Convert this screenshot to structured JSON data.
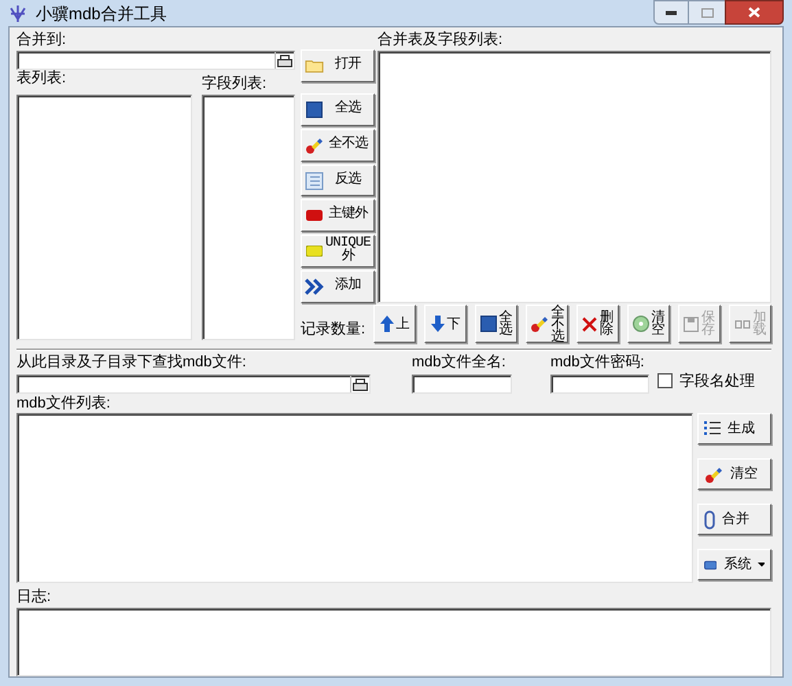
{
  "window": {
    "title": "小骥mdb合并工具"
  },
  "merge_to": {
    "label": "合并到:"
  },
  "table_list": {
    "label": "表列表:"
  },
  "field_list": {
    "label": "字段列表:"
  },
  "side_buttons": [
    {
      "label": "打开",
      "kind": "folder"
    },
    {
      "label": "全选",
      "kind": "square"
    },
    {
      "label": "全不选",
      "kind": "eraser"
    },
    {
      "label": "反选",
      "kind": "list"
    },
    {
      "label": "主键外",
      "kind": "red-pill"
    },
    {
      "label": "UNIQUE外",
      "kind": "yellow-pill"
    },
    {
      "label": "添加",
      "kind": "chevrons"
    }
  ],
  "merge_list": {
    "label": "合并表及字段列表:"
  },
  "record_count": {
    "label": "记录数量:"
  },
  "list_buttons": [
    {
      "label": "上",
      "kind": "up",
      "disabled": false
    },
    {
      "label": "下",
      "kind": "down",
      "disabled": false
    },
    {
      "label": "全选",
      "kind": "square",
      "disabled": false
    },
    {
      "label": "全不选",
      "kind": "eraser",
      "disabled": false
    },
    {
      "label": "删除",
      "kind": "x",
      "disabled": false
    },
    {
      "label": "清空",
      "kind": "disc",
      "disabled": false
    },
    {
      "label": "保存",
      "kind": "floppy",
      "disabled": true
    },
    {
      "label": "加载",
      "kind": "plug",
      "disabled": true
    }
  ],
  "search_dir": {
    "label": "从此目录及子目录下查找mdb文件:"
  },
  "file_name": {
    "label": "mdb文件全名:"
  },
  "password": {
    "label": "mdb文件密码:"
  },
  "field_name_option": {
    "label": "字段名处理",
    "checked": false
  },
  "file_list": {
    "label": "mdb文件列表:"
  },
  "action_buttons": [
    {
      "label": "生成",
      "kind": "list-bullets",
      "dropdown": false
    },
    {
      "label": "清空",
      "kind": "eraser",
      "dropdown": false
    },
    {
      "label": "合并",
      "kind": "clip",
      "dropdown": false
    },
    {
      "label": "系统",
      "kind": "blue-rect",
      "dropdown": true
    }
  ],
  "log": {
    "label": "日志:"
  }
}
